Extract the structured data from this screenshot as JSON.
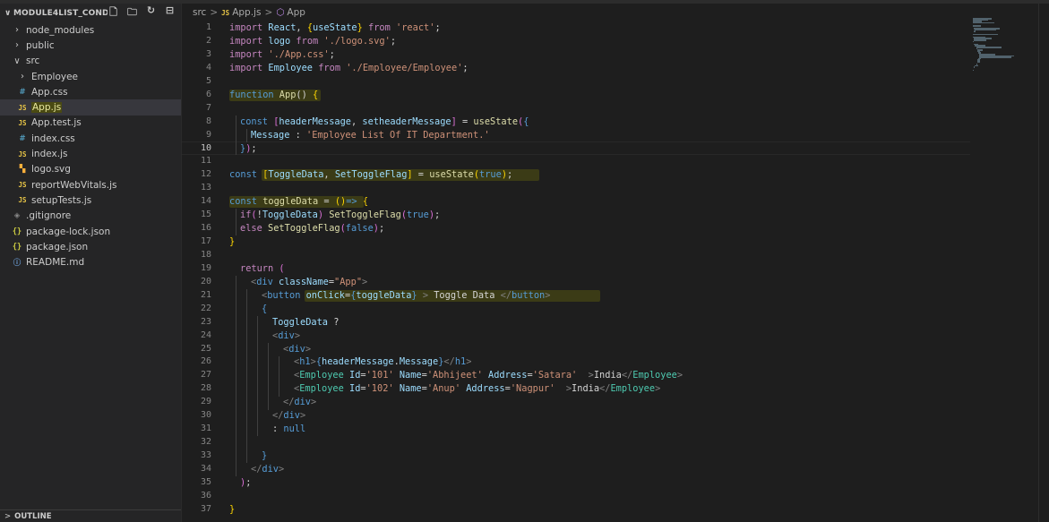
{
  "explorer": {
    "root_label": "MODULE4LIST_COND...",
    "actions": [
      "new-file-icon",
      "new-folder-icon",
      "refresh-icon",
      "collapse-all-icon"
    ],
    "items": [
      {
        "label": "node_modules",
        "icon": "chevron-right-icon",
        "type": "folder",
        "depth": 1
      },
      {
        "label": "public",
        "icon": "chevron-right-icon",
        "type": "folder",
        "depth": 1
      },
      {
        "label": "src",
        "icon": "chevron-down-icon",
        "type": "folder",
        "depth": 1
      },
      {
        "label": "Employee",
        "icon": "chevron-right-icon",
        "type": "folder",
        "depth": 2
      },
      {
        "label": "App.css",
        "icon": "css-file-icon",
        "type": "file",
        "depth": 2
      },
      {
        "label": "App.js",
        "icon": "js-file-icon",
        "type": "file",
        "depth": 2,
        "selected": true
      },
      {
        "label": "App.test.js",
        "icon": "js-file-icon",
        "type": "file",
        "depth": 2
      },
      {
        "label": "index.css",
        "icon": "css-file-icon",
        "type": "file",
        "depth": 2
      },
      {
        "label": "index.js",
        "icon": "js-file-icon",
        "type": "file",
        "depth": 2
      },
      {
        "label": "logo.svg",
        "icon": "svg-file-icon",
        "type": "file",
        "depth": 2
      },
      {
        "label": "reportWebVitals.js",
        "icon": "js-file-icon",
        "type": "file",
        "depth": 2
      },
      {
        "label": "setupTests.js",
        "icon": "js-file-icon",
        "type": "file",
        "depth": 2
      },
      {
        "label": ".gitignore",
        "icon": "gitignore-file-icon",
        "type": "file",
        "depth": 1
      },
      {
        "label": "package-lock.json",
        "icon": "json-file-icon",
        "type": "file",
        "depth": 1
      },
      {
        "label": "package.json",
        "icon": "json-file-icon",
        "type": "file",
        "depth": 1
      },
      {
        "label": "README.md",
        "icon": "info-file-icon",
        "type": "file",
        "depth": 1
      }
    ],
    "outline_label": "OUTLINE"
  },
  "breadcrumb": {
    "folder": "src",
    "file_badge": "JS",
    "file": "App.js",
    "symbol": "App"
  },
  "editor": {
    "active_line": 10,
    "lines": [
      {
        "n": "1",
        "indent": 0,
        "tokens": [
          [
            "import ",
            "k"
          ],
          [
            "React",
            "v"
          ],
          [
            ", ",
            "p"
          ],
          [
            "{",
            "y"
          ],
          [
            "useState",
            "v"
          ],
          [
            "}",
            "y"
          ],
          [
            " from ",
            "k"
          ],
          [
            "'react'",
            "s"
          ],
          [
            ";",
            "p"
          ]
        ]
      },
      {
        "n": "2",
        "indent": 0,
        "tokens": [
          [
            "import ",
            "k"
          ],
          [
            "logo",
            "v"
          ],
          [
            " from ",
            "k"
          ],
          [
            "'./logo.svg'",
            "s"
          ],
          [
            ";",
            "p"
          ]
        ]
      },
      {
        "n": "3",
        "indent": 0,
        "tokens": [
          [
            "import ",
            "k"
          ],
          [
            "'./App.css'",
            "s"
          ],
          [
            ";",
            "p"
          ]
        ]
      },
      {
        "n": "4",
        "indent": 0,
        "tokens": [
          [
            "import ",
            "k"
          ],
          [
            "Employee",
            "v"
          ],
          [
            " from ",
            "k"
          ],
          [
            "'./Employee/Employee'",
            "s"
          ],
          [
            ";",
            "p"
          ]
        ]
      },
      {
        "n": "5",
        "indent": 0,
        "tokens": []
      },
      {
        "n": "6",
        "indent": 0,
        "tokens": [
          [
            "function ",
            "b"
          ],
          [
            "App",
            "f"
          ],
          [
            "() ",
            "p"
          ],
          [
            "{",
            "y"
          ]
        ]
      },
      {
        "n": "7",
        "indent": 0,
        "tokens": []
      },
      {
        "n": "8",
        "indent": 1,
        "tokens": [
          [
            "const ",
            "b"
          ],
          [
            "[",
            "pb"
          ],
          [
            "headerMessage",
            "v"
          ],
          [
            ", ",
            "p"
          ],
          [
            "setheaderMessage",
            "v"
          ],
          [
            "]",
            "pb"
          ],
          [
            " = ",
            "p"
          ],
          [
            "useState",
            "f"
          ],
          [
            "(",
            "pb"
          ],
          [
            "{",
            "c"
          ]
        ]
      },
      {
        "n": "9",
        "indent": 2,
        "tokens": [
          [
            "Message",
            "v"
          ],
          [
            " : ",
            "p"
          ],
          [
            "'Employee List Of IT Department.'",
            "s"
          ]
        ]
      },
      {
        "n": "10",
        "indent": 1,
        "tokens": [
          [
            "}",
            "c"
          ],
          [
            ")",
            "pb"
          ],
          [
            ";",
            "p"
          ]
        ]
      },
      {
        "n": "11",
        "indent": 0,
        "tokens": []
      },
      {
        "n": "12",
        "indent": 0,
        "tokens": [
          [
            "const ",
            "b"
          ],
          [
            "[",
            "y"
          ],
          [
            "ToggleData",
            "v"
          ],
          [
            ", ",
            "p"
          ],
          [
            "SetToggleFlag",
            "v"
          ],
          [
            "]",
            "y"
          ],
          [
            " = ",
            "p"
          ],
          [
            "useState",
            "f"
          ],
          [
            "(",
            "y"
          ],
          [
            "true",
            "b"
          ],
          [
            ")",
            "y"
          ],
          [
            ";",
            "p"
          ]
        ]
      },
      {
        "n": "13",
        "indent": 0,
        "tokens": []
      },
      {
        "n": "14",
        "indent": 0,
        "tokens": [
          [
            "const ",
            "b"
          ],
          [
            "toggleData",
            "f"
          ],
          [
            " = ",
            "p"
          ],
          [
            "()",
            "y"
          ],
          [
            "=> ",
            "b"
          ],
          [
            "{",
            "y"
          ]
        ]
      },
      {
        "n": "15",
        "indent": 1,
        "tokens": [
          [
            "if",
            "k"
          ],
          [
            "(",
            "pb"
          ],
          [
            "!",
            "p"
          ],
          [
            "ToggleData",
            "v"
          ],
          [
            ") ",
            "pb"
          ],
          [
            "SetToggleFlag",
            "f"
          ],
          [
            "(",
            "pb"
          ],
          [
            "true",
            "b"
          ],
          [
            ")",
            "pb"
          ],
          [
            ";",
            "p"
          ]
        ]
      },
      {
        "n": "16",
        "indent": 1,
        "tokens": [
          [
            "else ",
            "k"
          ],
          [
            "SetToggleFlag",
            "f"
          ],
          [
            "(",
            "pb"
          ],
          [
            "false",
            "b"
          ],
          [
            ")",
            "pb"
          ],
          [
            ";",
            "p"
          ]
        ]
      },
      {
        "n": "17",
        "indent": 0,
        "tokens": [
          [
            "}",
            "y"
          ]
        ]
      },
      {
        "n": "18",
        "indent": 0,
        "tokens": []
      },
      {
        "n": "19",
        "indent": 1,
        "tokens": [
          [
            "return ",
            "k"
          ],
          [
            "(",
            "pb"
          ]
        ]
      },
      {
        "n": "20",
        "indent": 2,
        "tokens": [
          [
            "<",
            "tag"
          ],
          [
            "div ",
            "b"
          ],
          [
            "className",
            "v"
          ],
          [
            "=",
            "p"
          ],
          [
            "\"App\"",
            "s"
          ],
          [
            ">",
            "tag"
          ]
        ]
      },
      {
        "n": "21",
        "indent": 3,
        "tokens": [
          [
            "<",
            "tag"
          ],
          [
            "button ",
            "b"
          ],
          [
            "onClick",
            "v"
          ],
          [
            "=",
            "p"
          ],
          [
            "{",
            "c"
          ],
          [
            "toggleData",
            "v"
          ],
          [
            "}",
            "c"
          ],
          [
            " > ",
            "tag"
          ],
          [
            "Toggle Data ",
            "p"
          ],
          [
            "</",
            "tag"
          ],
          [
            "button",
            "b"
          ],
          [
            ">",
            "tag"
          ]
        ]
      },
      {
        "n": "22",
        "indent": 3,
        "tokens": [
          [
            "{",
            "c"
          ]
        ]
      },
      {
        "n": "23",
        "indent": 4,
        "tokens": [
          [
            "ToggleData",
            "v"
          ],
          [
            " ?",
            "p"
          ]
        ]
      },
      {
        "n": "24",
        "indent": 4,
        "tokens": [
          [
            "<",
            "tag"
          ],
          [
            "div",
            "b"
          ],
          [
            ">",
            "tag"
          ]
        ]
      },
      {
        "n": "25",
        "indent": 5,
        "tokens": [
          [
            "<",
            "tag"
          ],
          [
            "div",
            "b"
          ],
          [
            ">",
            "tag"
          ]
        ]
      },
      {
        "n": "26",
        "indent": 6,
        "tokens": [
          [
            "<",
            "tag"
          ],
          [
            "h1",
            "b"
          ],
          [
            ">",
            "tag"
          ],
          [
            "{",
            "c"
          ],
          [
            "headerMessage",
            "v"
          ],
          [
            ".",
            "p"
          ],
          [
            "Message",
            "v"
          ],
          [
            "}",
            "c"
          ],
          [
            "</",
            "tag"
          ],
          [
            "h1",
            "b"
          ],
          [
            ">",
            "tag"
          ]
        ]
      },
      {
        "n": "27",
        "indent": 6,
        "tokens": [
          [
            "<",
            "tag"
          ],
          [
            "Employee ",
            "t"
          ],
          [
            "Id",
            "v"
          ],
          [
            "=",
            "p"
          ],
          [
            "'101' ",
            "s"
          ],
          [
            "Name",
            "v"
          ],
          [
            "=",
            "p"
          ],
          [
            "'Abhijeet' ",
            "s"
          ],
          [
            "Address",
            "v"
          ],
          [
            "=",
            "p"
          ],
          [
            "'Satara' ",
            "s"
          ],
          [
            " >",
            "tag"
          ],
          [
            "India",
            "p"
          ],
          [
            "</",
            "tag"
          ],
          [
            "Employee",
            "t"
          ],
          [
            ">",
            "tag"
          ]
        ]
      },
      {
        "n": "28",
        "indent": 6,
        "tokens": [
          [
            "<",
            "tag"
          ],
          [
            "Employee ",
            "t"
          ],
          [
            "Id",
            "v"
          ],
          [
            "=",
            "p"
          ],
          [
            "'102' ",
            "s"
          ],
          [
            "Name",
            "v"
          ],
          [
            "=",
            "p"
          ],
          [
            "'Anup' ",
            "s"
          ],
          [
            "Address",
            "v"
          ],
          [
            "=",
            "p"
          ],
          [
            "'Nagpur' ",
            "s"
          ],
          [
            " >",
            "tag"
          ],
          [
            "India",
            "p"
          ],
          [
            "</",
            "tag"
          ],
          [
            "Employee",
            "t"
          ],
          [
            ">",
            "tag"
          ]
        ]
      },
      {
        "n": "29",
        "indent": 5,
        "tokens": [
          [
            "</",
            "tag"
          ],
          [
            "div",
            "b"
          ],
          [
            ">",
            "tag"
          ]
        ]
      },
      {
        "n": "30",
        "indent": 4,
        "tokens": [
          [
            "</",
            "tag"
          ],
          [
            "div",
            "b"
          ],
          [
            ">",
            "tag"
          ]
        ]
      },
      {
        "n": "31",
        "indent": 4,
        "tokens": [
          [
            ": ",
            "p"
          ],
          [
            "null",
            "b"
          ]
        ]
      },
      {
        "n": "32",
        "indent": 0,
        "tokens": []
      },
      {
        "n": "33",
        "indent": 3,
        "tokens": [
          [
            "}",
            "c"
          ]
        ]
      },
      {
        "n": "34",
        "indent": 2,
        "tokens": [
          [
            "</",
            "tag"
          ],
          [
            "div",
            "b"
          ],
          [
            ">",
            "tag"
          ]
        ]
      },
      {
        "n": "35",
        "indent": 1,
        "tokens": [
          [
            ")",
            "pb"
          ],
          [
            ";",
            "p"
          ]
        ]
      },
      {
        "n": "36",
        "indent": 0,
        "tokens": []
      },
      {
        "n": "37",
        "indent": 0,
        "tokens": [
          [
            "}",
            "y"
          ]
        ]
      }
    ]
  },
  "colors": {
    "editor_bg": "#1e1e1e",
    "sidebar_bg": "#252526",
    "selection_bg": "#37373d",
    "highlight_band": "#3b3b16"
  }
}
